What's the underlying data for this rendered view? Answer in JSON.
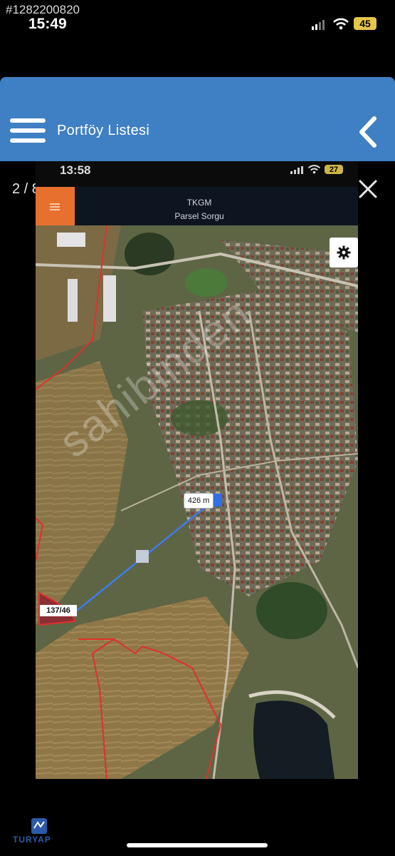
{
  "outer_status": {
    "watermark_id": "#1282200820",
    "time": "15:49",
    "battery": "45"
  },
  "header": {
    "title": "Portföy Listesi"
  },
  "gallery": {
    "counter": "2 / 8"
  },
  "inner": {
    "time": "13:58",
    "battery": "27",
    "title": "TKGM",
    "subtitle": "Parsel Sorgu"
  },
  "map": {
    "distance_label": "426 m",
    "parcel_label": "137/46",
    "watermark": "sahibinden",
    "colors": {
      "parcel_border": "#e0302c",
      "measure_line": "#3d7df0"
    }
  },
  "footer": {
    "logo_text": "TURYAP"
  },
  "colors": {
    "header_bg": "#3f7fc4",
    "inner_menu": "#e8702f"
  }
}
